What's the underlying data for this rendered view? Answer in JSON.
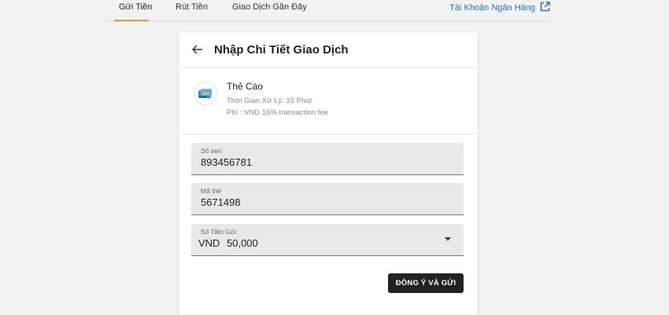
{
  "topnav": {
    "tabs": [
      "Gửi Tiền",
      "Rút Tiền",
      "Giao Dịch Gần Đây"
    ],
    "bank_link": "Tài Khoản Ngân Hàng",
    "accent_color": "#e0a040",
    "link_color": "#1a73b8"
  },
  "card": {
    "title": "Nhập Chi Tiết Giao Dịch",
    "back_icon": "arrow-left-icon"
  },
  "method": {
    "name": "Thẻ Cào",
    "processing_time": "Thời Gian Xử Lý: 15 Phút",
    "fee": "Phí : VND 16% transaction fee",
    "icon": "scratch-card-icon"
  },
  "form": {
    "serial": {
      "label": "Số seri",
      "value": "893456781"
    },
    "card_code": {
      "label": "Mã thẻ",
      "value": "5671498"
    },
    "amount": {
      "label": "Số Tiền Gửi",
      "currency": "VND",
      "value": "50,000"
    },
    "submit_label": "ĐỒNG Ý VÀ GỬI"
  }
}
